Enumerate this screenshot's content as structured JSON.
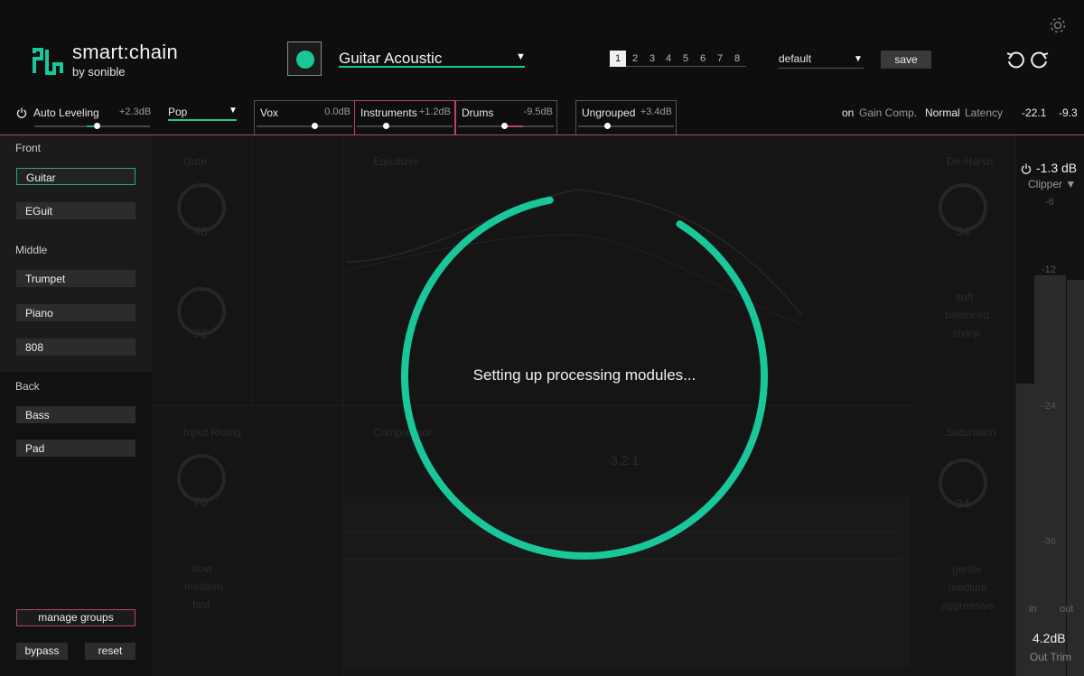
{
  "app": {
    "brand": "smart:chain",
    "brand_sub": "by sonible"
  },
  "header": {
    "preset_name": "Guitar Acoustic",
    "slots": [
      "1",
      "2",
      "3",
      "4",
      "5",
      "6",
      "7",
      "8"
    ],
    "active_slot": "1",
    "profile": "default",
    "save_label": "save"
  },
  "leveling": {
    "auto_label": "Auto Leveling",
    "auto_value": "+2.3dB",
    "genre": "Pop",
    "groups": [
      {
        "name": "Vox",
        "value": "0.0dB",
        "level": 0.6
      },
      {
        "name": "Instruments",
        "value": "+1.2dB",
        "level": 0.3
      },
      {
        "name": "Drums",
        "value": "-9.5dB",
        "level": 0.48
      },
      {
        "name": "Ungrouped",
        "value": "+3.4dB",
        "level": 0.3
      }
    ],
    "gain_comp_state": "on",
    "gain_comp_label": "Gain Comp.",
    "latency_mode": "Normal",
    "latency_label": "Latency",
    "meter_left": "-22.1",
    "meter_right": "-9.3"
  },
  "sidebar": {
    "sections": [
      {
        "title": "Front",
        "items": [
          "Guitar",
          "EGuit"
        ]
      },
      {
        "title": "Middle",
        "items": [
          "Trumpet",
          "Piano",
          "808"
        ]
      },
      {
        "title": "Back",
        "items": [
          "Bass",
          "Pad"
        ]
      }
    ],
    "selected": "Guitar",
    "manage_label": "manage groups",
    "bypass_label": "bypass",
    "reset_label": "reset"
  },
  "modules": {
    "gate": "Gate",
    "equalizer": "Equalizer",
    "deharsh": "De-Harsh",
    "input_riding": "Input Riding",
    "compressor": "Compressor",
    "saturation": "Saturation",
    "gate_val1": "48",
    "gate_val2": "92",
    "deharsh_val": "54",
    "riding_val": "70",
    "sat_val": "34",
    "comp_ratio": "3.2:1",
    "riding_modes": [
      "slow",
      "medium",
      "fast"
    ],
    "deharsh_modes": [
      "soft",
      "balanced",
      "sharp"
    ],
    "sat_modes": [
      "gentle",
      "medium",
      "aggressive"
    ]
  },
  "meter": {
    "output_value": "-1.3 dB",
    "clipper_label": "Clipper",
    "scale": [
      "-6",
      "-12",
      "-24",
      "-36"
    ],
    "in_label": "in",
    "out_label": "out",
    "out_trim_value": "4.2dB",
    "out_trim_label": "Out Trim"
  },
  "overlay": {
    "loading_text": "Setting up processing modules...",
    "progress": 0.88
  },
  "colors": {
    "accent": "#19c79a",
    "warn": "#b7475f",
    "bg": "#0d0d0e"
  }
}
